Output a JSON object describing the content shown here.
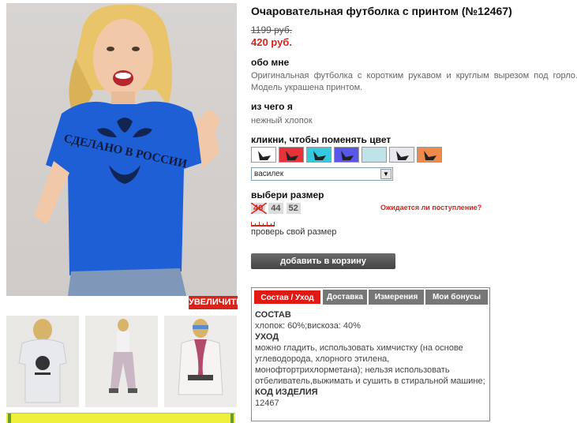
{
  "product": {
    "title": "Очаровательная футболка с принтом (№12467)",
    "old_price": "1199 руб.",
    "new_price": "420 руб."
  },
  "about": {
    "heading": "обо мне",
    "text": "Оригинальная футболка с коротким рукавом и круглым вырезом под горло. Модель украшена принтом."
  },
  "material": {
    "heading": "из чего я",
    "text": "нежный хлопок"
  },
  "colors": {
    "heading": "кликни, чтобы поменять цвет",
    "swatches": [
      "#ffffff",
      "#e8323b",
      "#35c9e0",
      "#5a57e8",
      "#bfe3e8",
      "#e8e8ee",
      "#f08a4a"
    ],
    "selected": "василек"
  },
  "sizes": {
    "heading": "выбери размер",
    "items": [
      {
        "label": "40",
        "available": false
      },
      {
        "label": "44",
        "available": true
      },
      {
        "label": "52",
        "available": true
      }
    ],
    "notify": "Ожидается ли поступление?",
    "check": "проверь свой размер"
  },
  "cart_button": "добавить в корзину",
  "zoom_button": "УВЕЛИЧИТЬ",
  "tabs": {
    "items": [
      "Состав / Уход",
      "Доставка",
      "Измерения",
      "Мои бонусы"
    ],
    "composition_title": "СОСТАВ",
    "composition": "хлопок: 60%;вискоза: 40%",
    "care_title": "УХОД",
    "care": "можно гладить, использовать химчистку (на основе углеводорода, хлорного этилена, монофтортрихлорметана); нельзя использовать отбеливатель,выжимать и сушить в стиральной машине;",
    "code_title": "КОД ИЗДЕЛИЯ",
    "code": "12467"
  },
  "print_text": "СДЕЛАНО В РОССИИ",
  "colors_theme": {
    "accent": "#d8251c",
    "shirt": "#1e5fd6"
  }
}
